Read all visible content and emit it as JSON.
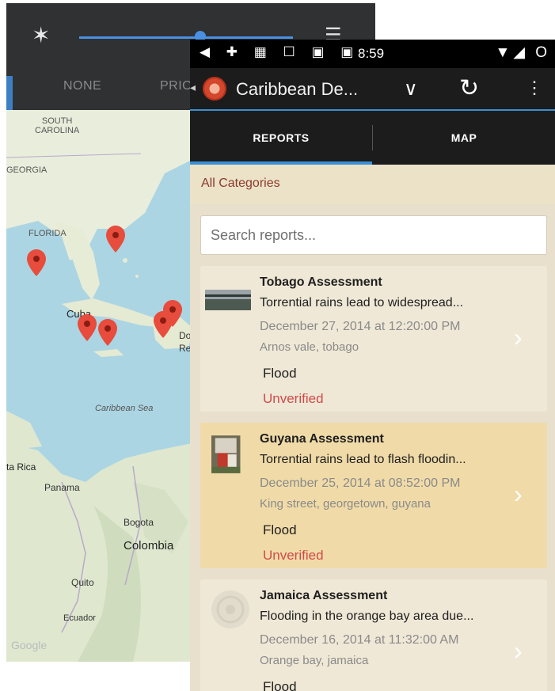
{
  "background_screen": {
    "notification_shade": {
      "modes": [
        "NONE",
        "PRIO"
      ]
    },
    "map": {
      "region_labels": [
        "SOUTH\nCAROLINA",
        "GEORGIA",
        "FLORIDA"
      ],
      "sea_label": "Caribbean Sea",
      "cities": [
        "Panama",
        "Bogota",
        "Quito"
      ],
      "countries": [
        "Cuba",
        "Colombia",
        "Ecuador",
        "ta Rica",
        "Dor",
        "Re"
      ],
      "attribution": "Google",
      "marker_color": "#e74c3c"
    }
  },
  "status_bar": {
    "left_icons": "◀ ✚ ▦ ☐ ▣ ▣",
    "time": "8:59",
    "right_icons": "▼◢ O"
  },
  "action_bar": {
    "title": "Caribbean De...",
    "icons": [
      "logo-icon",
      "chevron-down-icon",
      "sync-icon",
      "more-vert-icon"
    ]
  },
  "tabs": [
    {
      "label": "REPORTS",
      "active": true
    },
    {
      "label": "MAP",
      "active": false
    }
  ],
  "category_filter": "All Categories",
  "search": {
    "placeholder": "Search reports..."
  },
  "reports": [
    {
      "title": "Tobago Assessment",
      "description": "Torrential rains lead to widespread...",
      "date": "December 27, 2014 at 12:20:00 PM",
      "location": "Arnos vale, tobago",
      "category": "Flood",
      "status": "Unverified"
    },
    {
      "title": "Guyana Assessment",
      "description": "Torrential rains lead to flash floodin...",
      "date": "December 25, 2014 at 08:52:00 PM",
      "location": "King street, georgetown, guyana",
      "category": "Flood",
      "status": "Unverified"
    },
    {
      "title": "Jamaica Assessment",
      "description": "Flooding in the orange bay area due...",
      "date": "December 16, 2014 at 11:32:00 AM",
      "location": "Orange bay, jamaica",
      "category": "Flood",
      "status": ""
    }
  ],
  "colors": {
    "accent": "#3b8fd6",
    "unverified": "#d04a4a",
    "category_text": "#8b3a2a",
    "card_bg": "#efe8d6",
    "card_highlight": "#f0dba8"
  }
}
